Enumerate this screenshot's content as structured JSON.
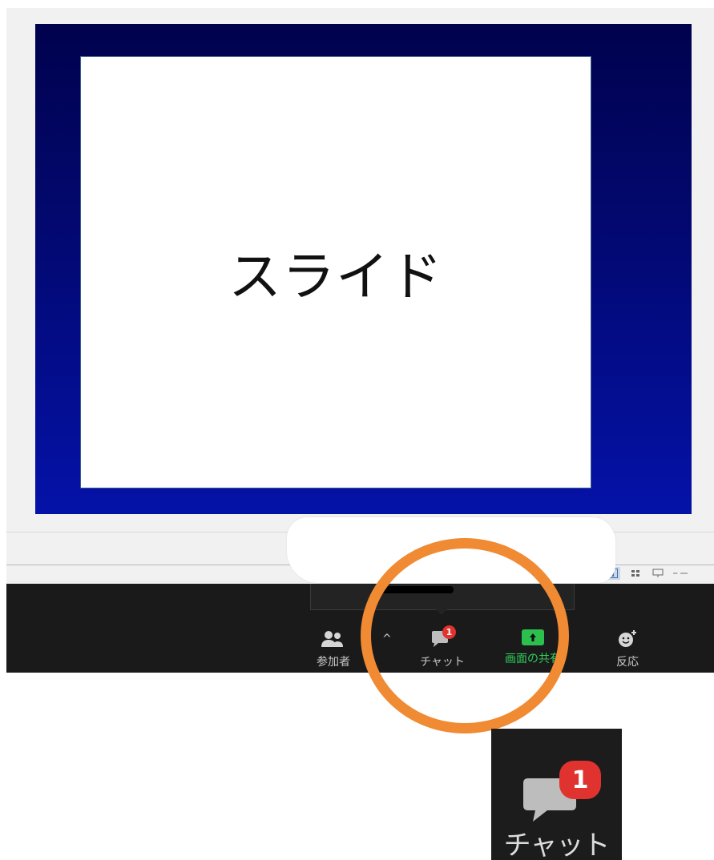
{
  "slide": {
    "text": "スライド"
  },
  "toolbar": {
    "participants_label": "参加者",
    "chat_label": "チャット",
    "chat_badge": "1",
    "share_label": "画面の共有",
    "reactions_label": "反応",
    "chevron": "^"
  },
  "zoom_inset": {
    "chat_label": "チャット",
    "chat_badge": "1"
  },
  "colors": {
    "highlight_ring": "#f08a33",
    "badge": "#e0332f",
    "share_green": "#2cbf4d",
    "slide_background": "#02086e"
  }
}
